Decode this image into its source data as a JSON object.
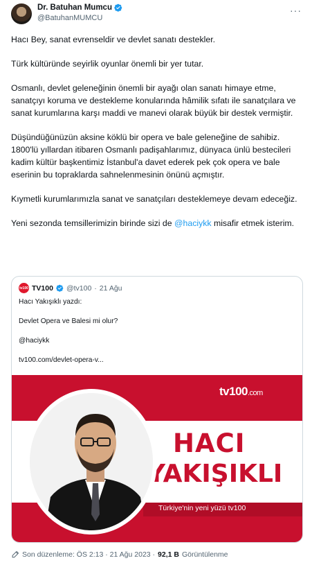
{
  "author": {
    "name": "Dr. Batuhan Mumcu",
    "handle": "@BatuhanMUMCU",
    "more_icon": "more-icon",
    "verified_color": "#1d9bf0"
  },
  "tweet": {
    "paragraphs": [
      "Hacı Bey, sanat evrenseldir ve devlet sanatı destekler.",
      "Türk kültüründe seyirlik oyunlar önemli bir yer tutar.",
      "Osmanlı, devlet geleneğinin önemli bir ayağı olan sanatı himaye etme, sanatçıyı koruma ve destekleme konularında hâmilik sıfatı ile sanatçılara ve sanat kurumlarına karşı maddi ve manevi olarak büyük bir destek vermiştir.",
      "Düşündüğünüzün aksine köklü bir opera ve bale geleneğine de sahibiz. 1800'lü yıllardan itibaren Osmanlı padişahlarımız, dünyaca ünlü bestecileri kadim kültür başkentimiz İstanbul'a davet ederek pek çok opera ve bale eserinin bu topraklarda sahnelenmesinin önünü açmıştır.",
      "Kıymetli kurumlarımızla sanat ve sanatçıları desteklemeye devam edeceğiz."
    ],
    "last_before": "Yeni sezonda temsillerimizin birinde sizi de ",
    "last_mention": "@haciykk",
    "last_after": " misafir etmek isterim."
  },
  "quote": {
    "avatar_text": "tv100",
    "name": "TV100",
    "handle": "@tv100",
    "separator": "·",
    "date": "21 Ağu",
    "lines": [
      "Hacı Yakışıklı yazdı:",
      "Devlet Opera ve Balesi mi olur?",
      "@haciykk",
      "tv100.com/devlet-opera-v..."
    ],
    "media": {
      "logo": "tv100",
      "logo_suffix": ".com",
      "headline_1": "HACI",
      "headline_2": "YAKIŞIKLI",
      "slogan": "Türkiye'nin yeni yüzü tv100",
      "brand_color": "#c8102e"
    }
  },
  "footer": {
    "edit_icon": "edit-icon",
    "edited_label": "Son düzenleme: ÖS 2:13 · 21 Ağu 2023 ·",
    "views_count": "92,1 B",
    "views_label": "Görüntülenme"
  }
}
